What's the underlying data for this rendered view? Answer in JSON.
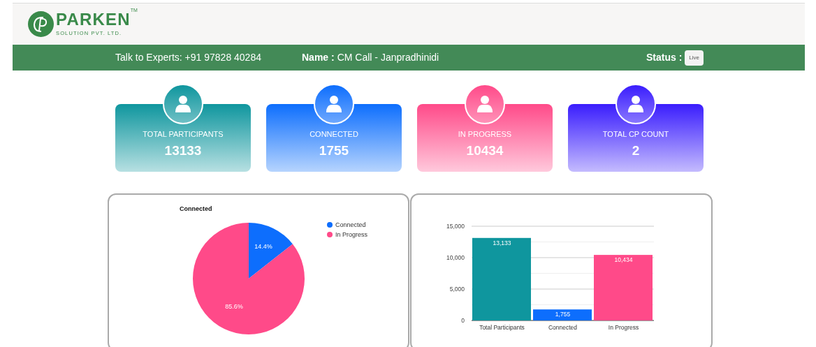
{
  "logo": {
    "name": "PARKEN",
    "trademark": "TM",
    "tagline": "SOLUTION PVT. LTD."
  },
  "info_bar": {
    "experts": "Talk to Experts: +91 97828 40284",
    "name_label": "Name :",
    "name_value": "CM Call - Janpradhinidi",
    "status_label": "Status :",
    "status_badge": "Live"
  },
  "stat_cards": [
    {
      "label": "TOTAL PARTICIPANTS",
      "value": "13133",
      "color": "#0f969e"
    },
    {
      "label": "CONNECTED",
      "value": "1755",
      "color": "#0d6efd"
    },
    {
      "label": "IN PROGRESS",
      "value": "10434",
      "color": "#ff4a89"
    },
    {
      "label": "TOTAL CP COUNT",
      "value": "2",
      "color": "#3a1dfd"
    }
  ],
  "pie_panel": {
    "chart_data": {
      "type": "pie",
      "title": "Connected",
      "categories": [
        "Connected",
        "In Progress"
      ],
      "series": [
        {
          "colors": [
            "#0d6efd",
            "#ff4a89"
          ],
          "values": [
            14.4,
            85.6
          ]
        }
      ],
      "value_labels": [
        "14.4%",
        "85.6%"
      ],
      "legend": "right"
    }
  },
  "bar_panel": {
    "chart_data": {
      "type": "bar",
      "categories": [
        "Total Participants",
        "Connected",
        "In Progress"
      ],
      "series": [
        {
          "colors": [
            "#0f969e",
            "#0d6efd",
            "#ff4a89"
          ],
          "values": [
            13133,
            1755,
            10434
          ]
        }
      ],
      "ylim": [
        0,
        15000
      ],
      "yticks": [
        {
          "value": 0,
          "label": "0"
        },
        {
          "value": 5000,
          "label": "5,000"
        },
        {
          "value": 10000,
          "label": "10,000"
        },
        {
          "value": 15000,
          "label": "15,000"
        }
      ],
      "value_labels": [
        "13,133",
        "1,755",
        "10,434"
      ]
    }
  }
}
